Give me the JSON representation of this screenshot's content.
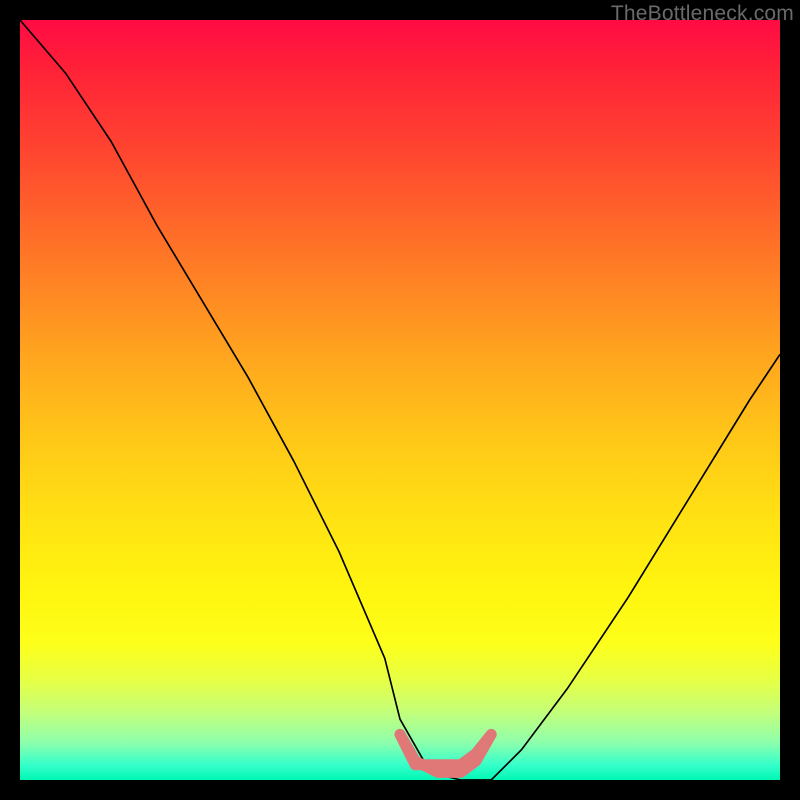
{
  "watermark": "TheBottleneck.com",
  "chart_data": {
    "type": "line",
    "title": "",
    "xlabel": "",
    "ylabel": "",
    "xlim": [
      0,
      100
    ],
    "ylim": [
      0,
      100
    ],
    "grid": false,
    "series": [
      {
        "name": "curve",
        "x": [
          0,
          6,
          12,
          18,
          24,
          30,
          36,
          42,
          48,
          50,
          54,
          58,
          62,
          66,
          72,
          80,
          88,
          96,
          100
        ],
        "y": [
          100,
          93,
          84,
          73,
          63,
          53,
          42,
          30,
          16,
          8,
          1,
          0,
          0,
          4,
          12,
          24,
          37,
          50,
          56
        ]
      }
    ],
    "annotations": [
      {
        "name": "pink-band",
        "shape": "path",
        "points_x": [
          50,
          52,
          55,
          58,
          60,
          62,
          60,
          58,
          55,
          52,
          50
        ],
        "points_y": [
          6,
          2.5,
          1,
          1,
          2.5,
          6,
          3.5,
          2,
          2,
          2,
          6
        ],
        "stroke": "#e07878",
        "stroke_width": 11
      }
    ],
    "background": "rainbow-vertical-gradient"
  }
}
